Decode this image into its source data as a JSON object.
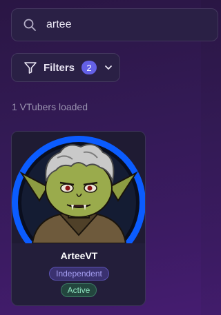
{
  "search": {
    "value": "artee",
    "icon": "search-icon"
  },
  "filters": {
    "label": "Filters",
    "active_count": "2",
    "icon": "filter-icon",
    "chevron": "chevron-down-icon"
  },
  "results": {
    "count_text": "1 VTubers loaded"
  },
  "cards": [
    {
      "name": "ArteeVT",
      "tags": [
        "Independent",
        "Active"
      ],
      "avatar_ring_color": "#0b5cff"
    }
  ],
  "colors": {
    "accent": "#6460e6",
    "independent_tag": "#a7a0f4",
    "active_tag": "#8ee3bf"
  }
}
